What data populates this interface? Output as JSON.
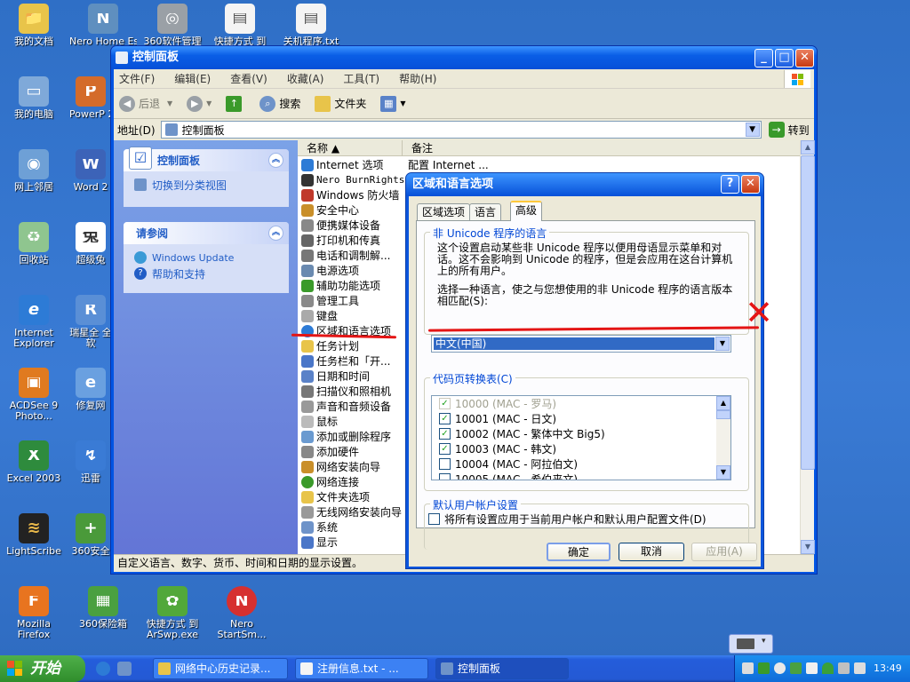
{
  "desktop": {
    "icons": [
      {
        "label": "我的文档",
        "color": "#e8c44a",
        "glyph": "📁"
      },
      {
        "label": "Nero Home Essent...",
        "color": "#5f8fbf",
        "glyph": "N"
      },
      {
        "label": "360软件管理",
        "color": "#9aa0a6",
        "glyph": "◎"
      },
      {
        "label": "快捷方式 到",
        "color": "#f4f4f4",
        "glyph": "▤"
      },
      {
        "label": "关机程序.txt",
        "color": "#f4f4f4",
        "glyph": "▤"
      },
      {
        "label": "我的电脑",
        "color": "#7fa9d9",
        "glyph": "▭"
      },
      {
        "label": "PowerP 200",
        "color": "#d46b2a",
        "glyph": "P"
      },
      {
        "label": "网上邻居",
        "color": "#6ea0d6",
        "glyph": "◉"
      },
      {
        "label": "Word 2",
        "color": "#3c63b8",
        "glyph": "W"
      },
      {
        "label": "回收站",
        "color": "#8fc58f",
        "glyph": "♻"
      },
      {
        "label": "超级兔",
        "color": "#ffffff",
        "glyph": "兔"
      },
      {
        "label": "Internet Explorer",
        "color": "#2d7bd6",
        "glyph": "e"
      },
      {
        "label": "瑞星全 全软",
        "color": "#5a8fd6",
        "glyph": "R"
      },
      {
        "label": "ACDSee 9 Photo...",
        "color": "#e07a1f",
        "glyph": "▣"
      },
      {
        "label": "修复网",
        "color": "#6aa0e0",
        "glyph": "e"
      },
      {
        "label": "Excel 2003",
        "color": "#2e8b3d",
        "glyph": "X"
      },
      {
        "label": "迅雷",
        "color": "#3a7bd5",
        "glyph": "↯"
      },
      {
        "label": "LightScribe",
        "color": "#222222",
        "glyph": "≋"
      },
      {
        "label": "360安全",
        "color": "#4a9a3a",
        "glyph": "+"
      },
      {
        "label": "Mozilla Firefox",
        "color": "#e8741f",
        "glyph": "F"
      },
      {
        "label": "360保险箱",
        "color": "#4aa040",
        "glyph": "▦"
      },
      {
        "label": "快捷方式 到 ArSwp.exe",
        "color": "#52a83a",
        "glyph": "✿"
      },
      {
        "label": "Nero StartSm...",
        "color": "#d63030",
        "glyph": "N"
      }
    ]
  },
  "window": {
    "title": "控制面板",
    "controls": {
      "min": "_",
      "max": "□",
      "close": "✕"
    },
    "menu": [
      "文件(F)",
      "编辑(E)",
      "查看(V)",
      "收藏(A)",
      "工具(T)",
      "帮助(H)"
    ],
    "toolbar": {
      "back": "后退",
      "search": "搜索",
      "folders": "文件夹"
    },
    "address": {
      "label": "地址(D)",
      "value": "控制面板",
      "go": "转到"
    },
    "left_panel": {
      "box1_title": "控制面板",
      "box1_item": "切换到分类视图",
      "box2_title": "请参阅",
      "box2_items": [
        "Windows Update",
        "帮助和支持"
      ]
    },
    "columns": {
      "name": "名称 ▲",
      "comment": "备注"
    },
    "items": [
      {
        "name": "Internet 选项",
        "comment": "配置 Internet ..."
      },
      {
        "name": "Nero BurnRights",
        "comment": ""
      },
      {
        "name": "Windows 防火墙",
        "comment": ""
      },
      {
        "name": "安全中心",
        "comment": ""
      },
      {
        "name": "便携媒体设备",
        "comment": ""
      },
      {
        "name": "打印机和传真",
        "comment": ""
      },
      {
        "name": "电话和调制解...",
        "comment": ""
      },
      {
        "name": "电源选项",
        "comment": ""
      },
      {
        "name": "辅助功能选项",
        "comment": ""
      },
      {
        "name": "管理工具",
        "comment": ""
      },
      {
        "name": "键盘",
        "comment": ""
      },
      {
        "name": "区域和语言选项",
        "comment": ""
      },
      {
        "name": "任务计划",
        "comment": ""
      },
      {
        "name": "任务栏和「开...",
        "comment": ""
      },
      {
        "name": "日期和时间",
        "comment": ""
      },
      {
        "name": "扫描仪和照相机",
        "comment": ""
      },
      {
        "name": "声音和音频设备",
        "comment": ""
      },
      {
        "name": "鼠标",
        "comment": ""
      },
      {
        "name": "添加或删除程序",
        "comment": ""
      },
      {
        "name": "添加硬件",
        "comment": ""
      },
      {
        "name": "网络安装向导",
        "comment": ""
      },
      {
        "name": "网络连接",
        "comment": ""
      },
      {
        "name": "文件夹选项",
        "comment": ""
      },
      {
        "name": "无线网络安装向导",
        "comment": ""
      },
      {
        "name": "系统",
        "comment": ""
      },
      {
        "name": "显示",
        "comment": ""
      }
    ],
    "status": "自定义语言、数字、货币、时间和日期的显示设置。"
  },
  "dialog": {
    "title": "区域和语言选项",
    "help": "?",
    "close": "✕",
    "tabs": [
      "区域选项",
      "语言",
      "高级"
    ],
    "group1_title": "非 Unicode 程序的语言",
    "group1_desc": [
      "这个设置启动某些非 Unicode 程序以便用母语显示菜单和对",
      "话。这不会影响到 Unicode 的程序，但是会应用在这台计算机",
      "上的所有用户。"
    ],
    "group1_prompt": [
      "选择一种语言，使之与您想使用的非 Unicode 程序的语言版本",
      "相匹配(S):"
    ],
    "selected_language": "中文(中国)",
    "group2_title": "代码页转换表(C)",
    "codepages": [
      {
        "label": "10000  (MAC - 罗马)",
        "checked": true,
        "disabled": true
      },
      {
        "label": "10001  (MAC - 日文)",
        "checked": true,
        "disabled": false
      },
      {
        "label": "10002  (MAC - 繁体中文 Big5)",
        "checked": true,
        "disabled": false
      },
      {
        "label": "10003  (MAC - 韩文)",
        "checked": true,
        "disabled": false
      },
      {
        "label": "10004  (MAC - 阿拉伯文)",
        "checked": false,
        "disabled": false
      },
      {
        "label": "10005  (MAC - 希伯来文)",
        "checked": false,
        "disabled": false
      }
    ],
    "group3_title": "默认用户帐户设置",
    "apply_all_label": "将所有设置应用于当前用户帐户和默认用户配置文件(D)",
    "buttons": {
      "ok": "确定",
      "cancel": "取消",
      "apply": "应用(A)"
    }
  },
  "taskbar": {
    "start": "开始",
    "items": [
      "网络中心历史记录...",
      "注册信息.txt - ...",
      "控制面板"
    ],
    "clock": "13:49"
  },
  "annotation_color": "#e41515"
}
